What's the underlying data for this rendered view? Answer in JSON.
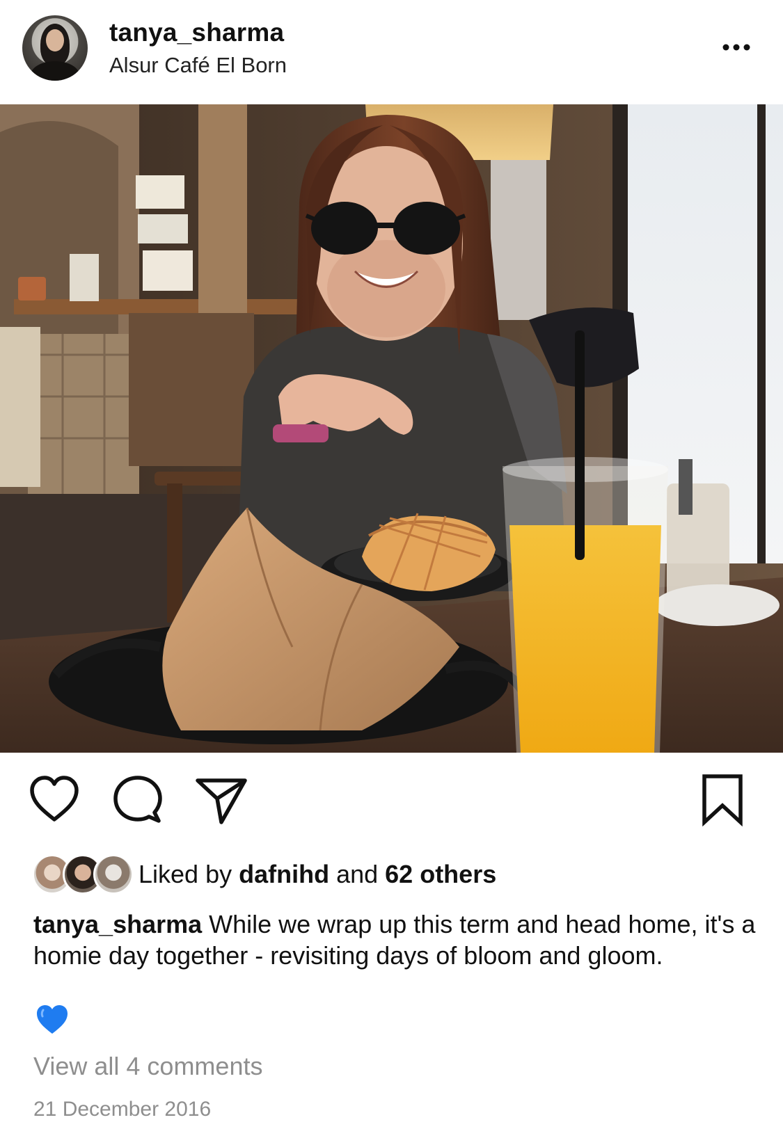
{
  "post": {
    "username": "tanya_sharma",
    "location": "Alsur Café El Born",
    "more_icon": "more-horizontal-icon",
    "photo_icon": "photo"
  },
  "actions": {
    "like_icon": "heart-outline-icon",
    "comment_icon": "comment-bubble-icon",
    "share_icon": "paper-plane-icon",
    "save_icon": "bookmark-outline-icon"
  },
  "likes": {
    "prefix": "Liked by ",
    "first_user": "dafnihd",
    "middle": " and ",
    "others": "62 others"
  },
  "caption": {
    "username": "tanya_sharma",
    "text": " While we wrap up this term and head home, it's a homie day together - revisiting days of bloom and gloom.",
    "emoji": "💙"
  },
  "comments": {
    "view_all": "View all 4 comments"
  },
  "date": "21 December 2016",
  "colors": {
    "text": "#111111",
    "muted": "#8e8e8e",
    "heart_emoji": "#1f7cf0"
  }
}
